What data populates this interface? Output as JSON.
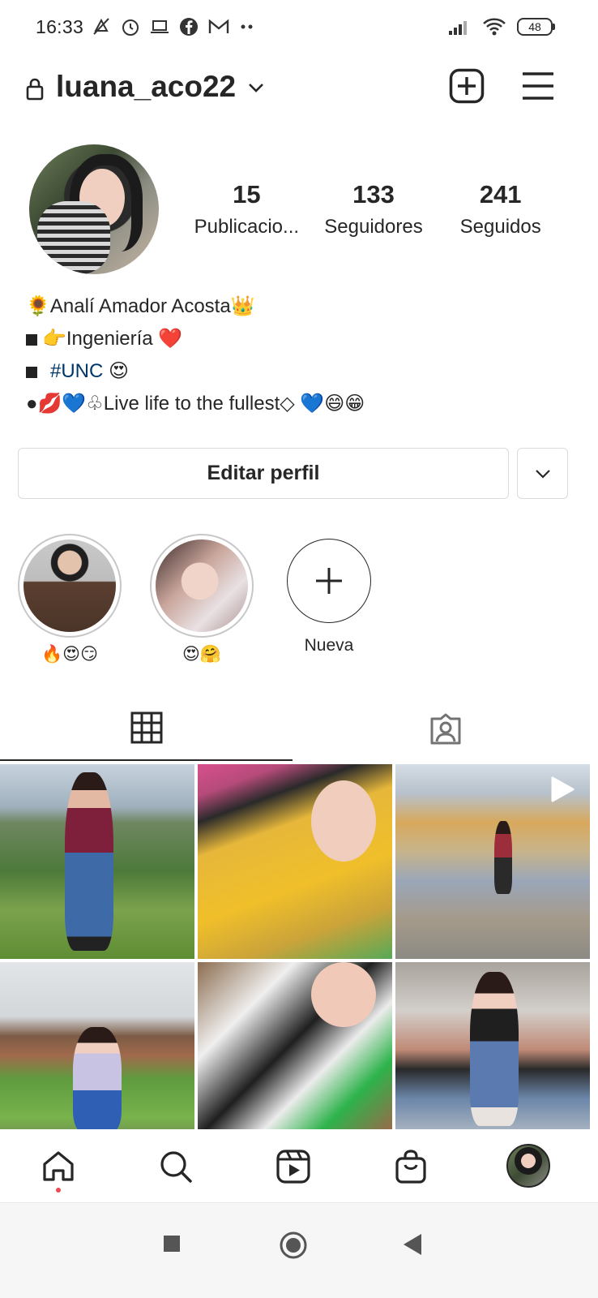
{
  "status_bar": {
    "time": "16:33",
    "battery": "48",
    "icons_left": [
      "mute-icon",
      "alarm-icon",
      "laptop-icon",
      "facebook-icon",
      "gmail-icon",
      "more-dots-icon"
    ],
    "icons_right": [
      "signal-icon",
      "wifi-icon",
      "battery-icon"
    ]
  },
  "header": {
    "username": "luana_aco22"
  },
  "profile": {
    "stats": [
      {
        "value": "15",
        "label": "Publicacio..."
      },
      {
        "value": "133",
        "label": "Seguidores"
      },
      {
        "value": "241",
        "label": "Seguidos"
      }
    ],
    "bio": {
      "line1": "🌻Analí Amador Acosta👑",
      "line2": "👉Ingeniería ❤️",
      "line3_hashtag": "#UNC",
      "line3_emoji": "😍",
      "line4": "●💋💙♧Live life to the fullest◇ 💙😄😁"
    },
    "edit_button": "Editar perfil"
  },
  "highlights": [
    {
      "caption": "🔥😍😏"
    },
    {
      "caption": "😍🤗"
    },
    {
      "caption": "Nueva"
    }
  ],
  "tabs": [
    {
      "name": "grid",
      "active": true
    },
    {
      "name": "tagged",
      "active": false
    }
  ],
  "bottom_nav": [
    "home-icon",
    "search-icon",
    "reels-icon",
    "shop-icon",
    "profile-avatar"
  ],
  "colors": {
    "text": "#262626",
    "hashtag": "#00376b",
    "border": "#dbdbdb",
    "notification_dot": "#ed4956"
  }
}
